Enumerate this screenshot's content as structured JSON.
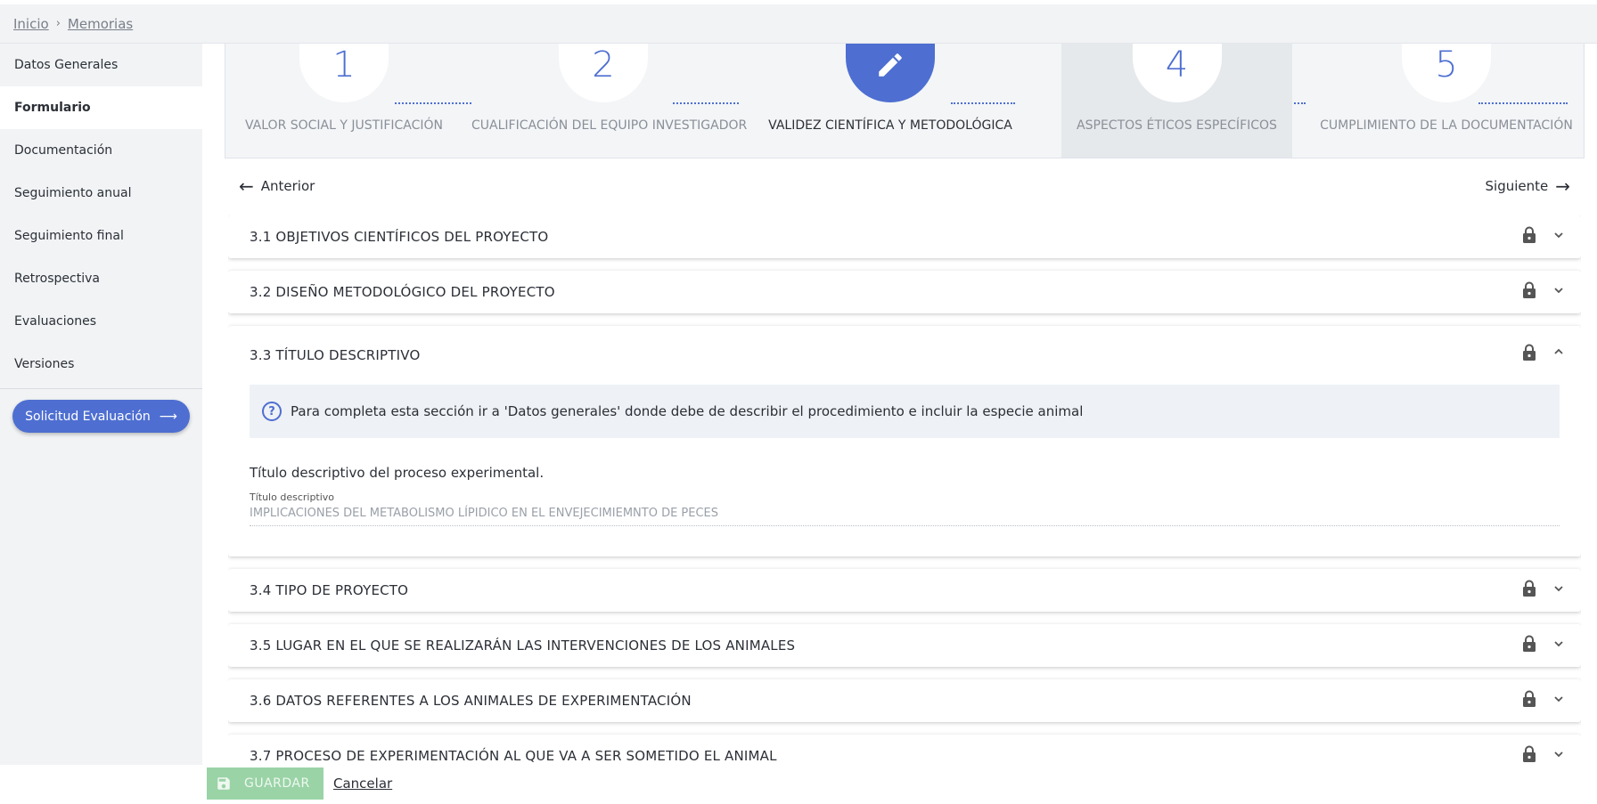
{
  "breadcrumb": {
    "home": "Inicio",
    "separator": "›",
    "current": "Memorias"
  },
  "sidebar": {
    "items": [
      {
        "label": "Datos Generales"
      },
      {
        "label": "Formulario"
      },
      {
        "label": "Documentación"
      },
      {
        "label": "Seguimiento anual"
      },
      {
        "label": "Seguimiento final"
      },
      {
        "label": "Retrospectiva"
      },
      {
        "label": "Evaluaciones"
      },
      {
        "label": "Versiones"
      }
    ],
    "active_item": "Formulario",
    "request_button": "Solicitud Evaluación",
    "request_button_arrow": "⟶"
  },
  "stepper": {
    "steps": [
      {
        "number": "1",
        "label": "VALOR SOCIAL Y JUSTIFICACIÓN"
      },
      {
        "number": "2",
        "label": "CUALIFICACIÓN DEL EQUIPO INVESTIGADOR"
      },
      {
        "number": "",
        "label": "VALIDEZ CIENTÍFICA Y METODOLÓGICA",
        "icon": "pencil-icon"
      },
      {
        "number": "4",
        "label": "ASPECTOS ÉTICOS ESPECÍFICOS"
      },
      {
        "number": "5",
        "label": "CUMPLIMIENTO DE LA DOCUMENTACIÓN"
      }
    ],
    "current_step": 3
  },
  "nav": {
    "prev": "Anterior",
    "next": "Siguiente"
  },
  "sections": [
    {
      "title": "3.1 OBJETIVOS CIENTÍFICOS DEL PROYECTO"
    },
    {
      "title": "3.2 DISEÑO METODOLÓGICO DEL PROYECTO"
    },
    {
      "title": "3.3 TÍTULO DESCRIPTIVO",
      "info": "Para completa esta sección ir a 'Datos generales' donde debe de describir el procedimiento e incluir la especie animal",
      "field_description": "Título descriptivo del proceso experimental.",
      "field_label": "Título descriptivo",
      "field_value": "IMPLICACIONES DEL METABOLISMO LÍPIDICO EN EL ENVEJECIMIEMNTO DE PECES"
    },
    {
      "title": "3.4 TIPO DE PROYECTO"
    },
    {
      "title": "3.5 LUGAR EN EL QUE SE REALIZARÁN LAS INTERVENCIONES DE LOS ANIMALES"
    },
    {
      "title": "3.6 DATOS REFERENTES A LOS ANIMALES DE EXPERIMENTACIÓN"
    },
    {
      "title": "3.7 PROCESO DE EXPERIMENTACIÓN AL QUE VA A SER SOMETIDO EL ANIMAL"
    }
  ],
  "footer": {
    "save": "GUARDAR",
    "cancel": "Cancelar"
  },
  "colors": {
    "accent": "#4e6fd1",
    "save_disabled": "#9ad3a6",
    "sidebar_bg": "#f1f3f5"
  }
}
